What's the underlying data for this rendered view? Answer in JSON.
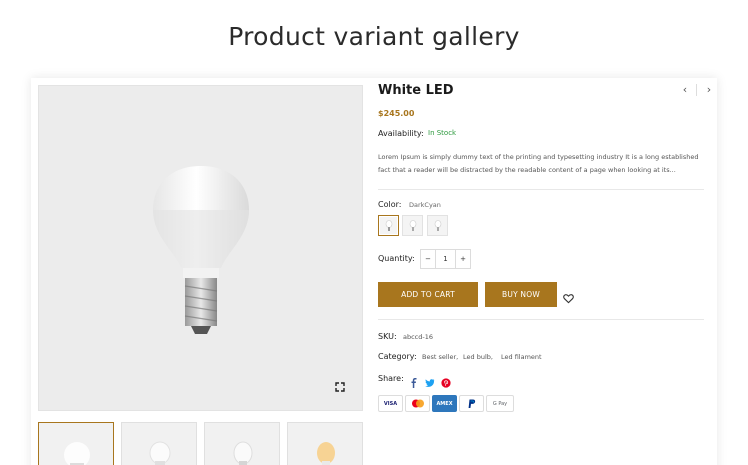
{
  "page": {
    "heading": "Product variant gallery"
  },
  "product": {
    "title": "White LED",
    "price": "$245.00",
    "availability_label": "Availability:",
    "availability_value": "In Stock",
    "description": "Lorem Ipsum is simply dummy text of the printing and typesetting industry It is a long established fact that a reader will be distracted by the readable content of a page when looking at its...",
    "color_label": "Color:",
    "color_value": "DarkCyan",
    "quantity_label": "Quantity:",
    "quantity_minus": "−",
    "quantity_value": "1",
    "quantity_plus": "+",
    "add_to_cart": "ADD TO CART",
    "buy_now": "BUY NOW",
    "sku_label": "SKU:",
    "sku_value": "abccd-16",
    "category_label": "Category:",
    "categories": [
      "Best seller,",
      "Led bulb,",
      "Led filament"
    ],
    "share_label": "Share:",
    "share_icons": [
      "facebook-icon",
      "twitter-icon",
      "pinterest-icon"
    ],
    "payment_methods": [
      "VISA",
      "Mastercard",
      "AMEX",
      "PayPal",
      "G Pay"
    ]
  },
  "gallery": {
    "thumbnails": [
      "white-bulb",
      "white-bulb-front",
      "white-bulb-side",
      "warm-bulb"
    ],
    "active_thumbnail": 0
  },
  "colors": {
    "accent": "#a8761e",
    "in_stock": "#2e9a3f",
    "facebook": "#3b5998",
    "twitter": "#1da1f2",
    "pinterest": "#e60023"
  }
}
